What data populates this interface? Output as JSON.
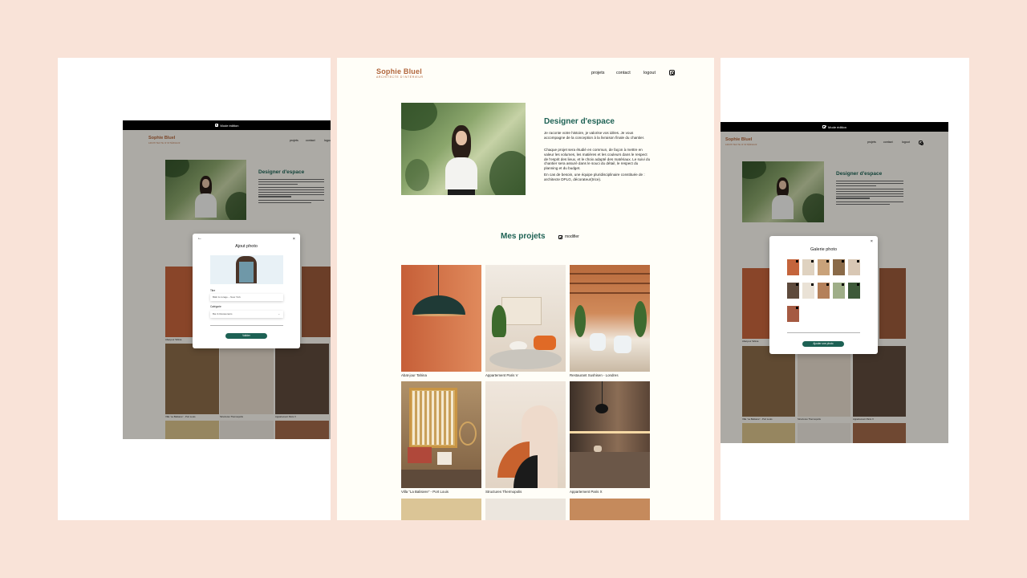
{
  "site": {
    "brand": "Sophie Bluel",
    "tagline": "Architecte d'intérieur",
    "nav": [
      "projets",
      "contact",
      "logout"
    ],
    "instagram_icon": "instagram-icon"
  },
  "about": {
    "title": "Designer d'espace",
    "paragraphs": [
      "Je raconte votre histoire, je valorise vos idées. Je vous accompagne de la conception à la livraison finale du chantier.",
      "Chaque projet sera étudié en commun, de façon à mettre en valeur les volumes, les matières et les couleurs dans le respect de l'esprit des lieux, et le choix adapté des matériaux. Le suivi du chantier sera assuré dans le souci du détail, le respect du planning et du budget.",
      "En cas de besoin, une équipe pluridisciplinaire constituée de : architecte DPLG, décorateur(trice)."
    ]
  },
  "portfolio": {
    "title": "Mes projets",
    "edit_label": "modifier",
    "works": [
      {
        "title": "Abat-jour Tahina"
      },
      {
        "title": "Appartement Paris V"
      },
      {
        "title": "Restaurant Sushisen - Londres"
      },
      {
        "title": "Villa “La Balisiere” - Port Louis"
      },
      {
        "title": "Structures Thermopolis"
      },
      {
        "title": "Appartement Paris X"
      }
    ]
  },
  "edit_mode": {
    "label": "Mode édition"
  },
  "add_photo_modal": {
    "title": "Ajout photo",
    "title_label": "Titre",
    "title_value": "Bâtit & curage – New York",
    "category_label": "Catégorie",
    "category_value": "Bar & Restaurants",
    "submit_label": "Valider",
    "close": "×",
    "back": "←"
  },
  "gallery_modal": {
    "title": "Galerie photo",
    "add_label": "Ajouter une photo",
    "close": "×"
  },
  "colors": {
    "brand": "#b1663c",
    "accent": "#1d6154",
    "background": "#f9e3d8"
  }
}
